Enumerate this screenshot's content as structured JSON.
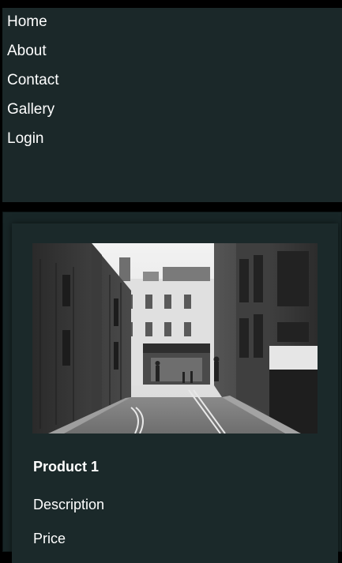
{
  "nav": {
    "items": [
      {
        "label": "Home"
      },
      {
        "label": "About"
      },
      {
        "label": "Contact"
      },
      {
        "label": "Gallery"
      },
      {
        "label": "Login"
      }
    ]
  },
  "product": {
    "title": "Product 1",
    "description": "Description",
    "price": "Price",
    "image": "street-photo-image"
  },
  "colors": {
    "nav_bg": "#1b2829",
    "card_bg": "#1b292a",
    "page_bg": "#000000",
    "text": "#ffffff"
  }
}
